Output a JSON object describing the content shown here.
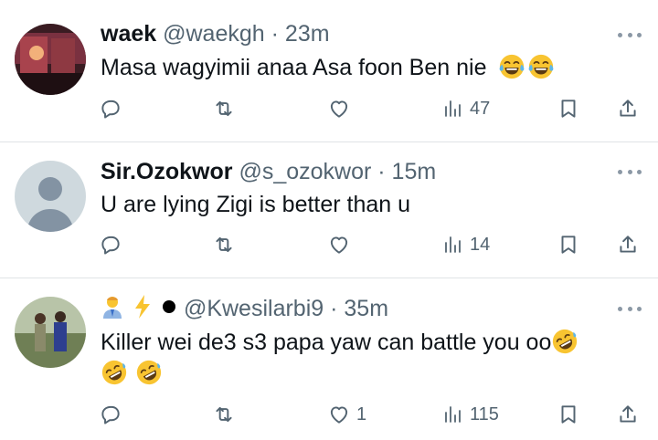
{
  "tweets": [
    {
      "name": "waek",
      "handle": "@waekgh",
      "dot": "·",
      "time": "23m",
      "text": "Masa wagyimii anaa Asa foon Ben nie",
      "emojis": [
        "joy-emoji",
        "joy-emoji"
      ],
      "likes": "",
      "views": "47"
    },
    {
      "name": "Sir.Ozokwor",
      "handle": "@s_ozokwor",
      "dot": "·",
      "time": "15m",
      "text": "U are lying Zigi is better than u",
      "emojis": [],
      "likes": "",
      "views": "14"
    },
    {
      "name": "",
      "handle": "@Kwesilarbi9",
      "dot": "·",
      "time": "35m",
      "name_icons": [
        "man-office-worker-emoji",
        "lightning-emoji",
        "black-circle-emoji"
      ],
      "text": "Killer wei de3 s3 papa yaw can battle you oo",
      "emojis": [
        "rofl-emoji",
        "rofl-emoji",
        "rofl-emoji"
      ],
      "likes": "1",
      "views": "115"
    }
  ],
  "colors": {
    "text": "#0f1419",
    "secondary": "#536471",
    "divider": "#dfe3e6",
    "emoji_yellow": "#f8c431"
  }
}
